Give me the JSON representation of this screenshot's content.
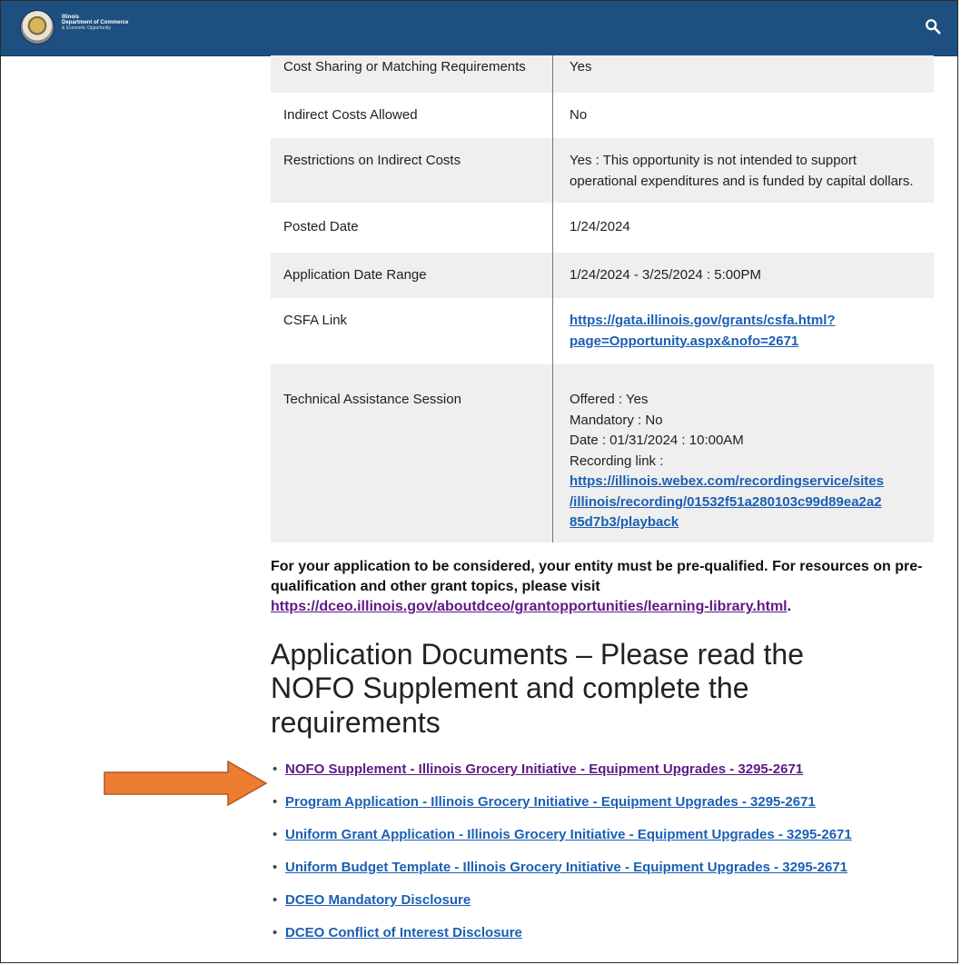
{
  "header": {
    "logo_line1": "Illinois",
    "logo_line2": "Department of Commerce",
    "logo_line3": "& Economic Opportunity",
    "brand_color": "#1d4f80"
  },
  "table_rows": [
    {
      "label": "Cost Sharing or Matching Requirements",
      "value": "Yes"
    },
    {
      "label": "Indirect Costs Allowed",
      "value": "No"
    },
    {
      "label": "Restrictions on Indirect Costs",
      "value": "Yes : This opportunity is not intended to support operational expenditures and is funded by capital dollars."
    },
    {
      "label": "Posted Date",
      "value": "1/24/2024"
    },
    {
      "label": "Application Date Range",
      "value": "1/24/2024 - 3/25/2024 : 5:00PM"
    },
    {
      "label": "CSFA Link",
      "link_line1": "https://gata.illinois.gov/grants/csfa.html?",
      "link_line2": "page=Opportunity.aspx&nofo=2671"
    },
    {
      "label": "Technical Assistance Session",
      "offered": "Offered : Yes",
      "mandatory": "Mandatory : No",
      "date": "Date : 01/31/2024 : 10:00AM",
      "recording_label": "Recording link :",
      "recording_line1": "https://illinois.webex.com/recordingservice/sites",
      "recording_line2": "/illinois/recording/01532f51a280103c99d89ea2a2",
      "recording_line3": "85d7b3/playback"
    }
  ],
  "notice": {
    "text": "For your application to be considered, your entity must be pre-qualified. For resources on pre-qualification and other grant topics, please visit ",
    "link": "https://dceo.illinois.gov/aboutdceo/grantopportunities/learning-library.html",
    "period": "."
  },
  "documents": {
    "heading": "Application Documents – Please read the NOFO Supplement and complete the requirements",
    "items": [
      "NOFO Supplement - Illinois Grocery Initiative - Equipment Upgrades - 3295-2671",
      "Program Application - Illinois Grocery Initiative - Equipment Upgrades - 3295-2671",
      "Uniform Grant Application - Illinois Grocery Initiative - Equipment Upgrades - 3295-2671",
      "Uniform Budget Template - Illinois Grocery Initiative - Equipment Upgrades - 3295-2671",
      "DCEO Mandatory Disclosure",
      "DCEO Conflict of Interest Disclosure"
    ],
    "bullet": "•"
  },
  "annotation": {
    "arrow_color": "#ed7d31",
    "arrow_border": "#ae5a21"
  },
  "icons": {
    "search": "search-icon",
    "seal": "state-seal-icon"
  }
}
